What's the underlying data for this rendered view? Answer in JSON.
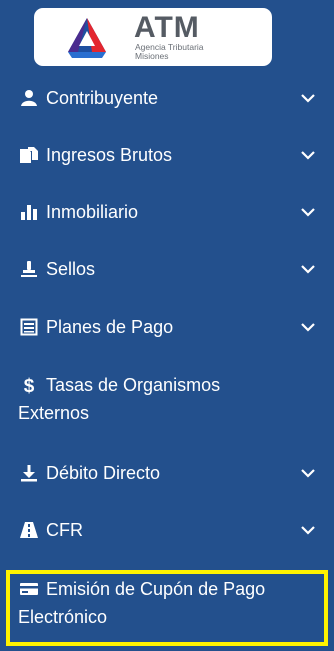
{
  "logo": {
    "title": "ATM",
    "subtitle_line1": "Agencia Tributaria",
    "subtitle_line2": "Misiones"
  },
  "menu": [
    {
      "label": "Contribuyente",
      "icon": "user-icon",
      "has_chevron": true
    },
    {
      "label": "Ingresos Brutos",
      "icon": "documents-icon",
      "has_chevron": true
    },
    {
      "label": "Inmobiliario",
      "icon": "bar-chart-icon",
      "has_chevron": true
    },
    {
      "label": "Sellos",
      "icon": "stamp-icon",
      "has_chevron": true
    },
    {
      "label": "Planes de Pago",
      "icon": "list-icon",
      "has_chevron": true
    },
    {
      "label_line1": "Tasas de Organismos",
      "label_line2": "Externos",
      "icon": "dollar-icon",
      "has_chevron": false
    },
    {
      "label": "Débito Directo",
      "icon": "download-icon",
      "has_chevron": true
    },
    {
      "label": "CFR",
      "icon": "road-icon",
      "has_chevron": true
    },
    {
      "label_line1": "Emisión de Cupón de Pago",
      "label_line2": "Electrónico",
      "icon": "credit-card-icon",
      "has_chevron": false,
      "highlighted": true
    }
  ],
  "colors": {
    "background": "#23508d",
    "text": "#ffffff",
    "highlight_border": "#fff200"
  }
}
